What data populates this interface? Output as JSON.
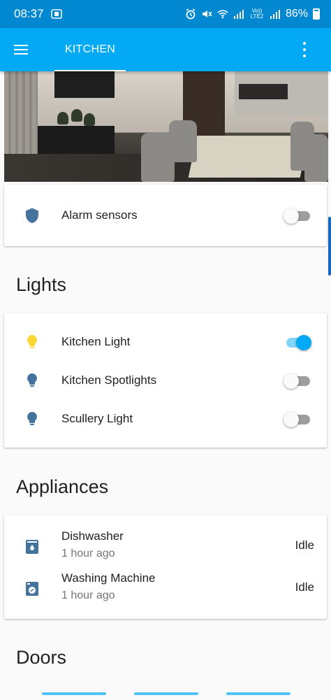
{
  "status_bar": {
    "time": "08:37",
    "network": "Vo)) LTE2",
    "battery": "86%"
  },
  "app_bar": {
    "tab_label": "KITCHEN",
    "menu_icon": "menu-icon",
    "overflow_icon": "more-vert-icon"
  },
  "colors": {
    "primary": "#03a9f4",
    "status_bar": "#0288d1",
    "icon_off": "#44739e",
    "icon_on": "#fdd835"
  },
  "alarm_card": {
    "label": "Alarm sensors",
    "icon": "shield-icon",
    "toggle_on": false
  },
  "lights": {
    "title": "Lights",
    "items": [
      {
        "label": "Kitchen Light",
        "icon": "lightbulb-icon",
        "on": true
      },
      {
        "label": "Kitchen Spotlights",
        "icon": "lightbulb-icon",
        "on": false
      },
      {
        "label": "Scullery Light",
        "icon": "lightbulb-icon",
        "on": false
      }
    ]
  },
  "appliances": {
    "title": "Appliances",
    "items": [
      {
        "label": "Dishwasher",
        "sub": "1 hour ago",
        "state": "Idle",
        "icon": "dishwasher-icon"
      },
      {
        "label": "Washing Machine",
        "sub": "1 hour ago",
        "state": "Idle",
        "icon": "washing-machine-icon"
      }
    ]
  },
  "doors": {
    "title": "Doors"
  }
}
